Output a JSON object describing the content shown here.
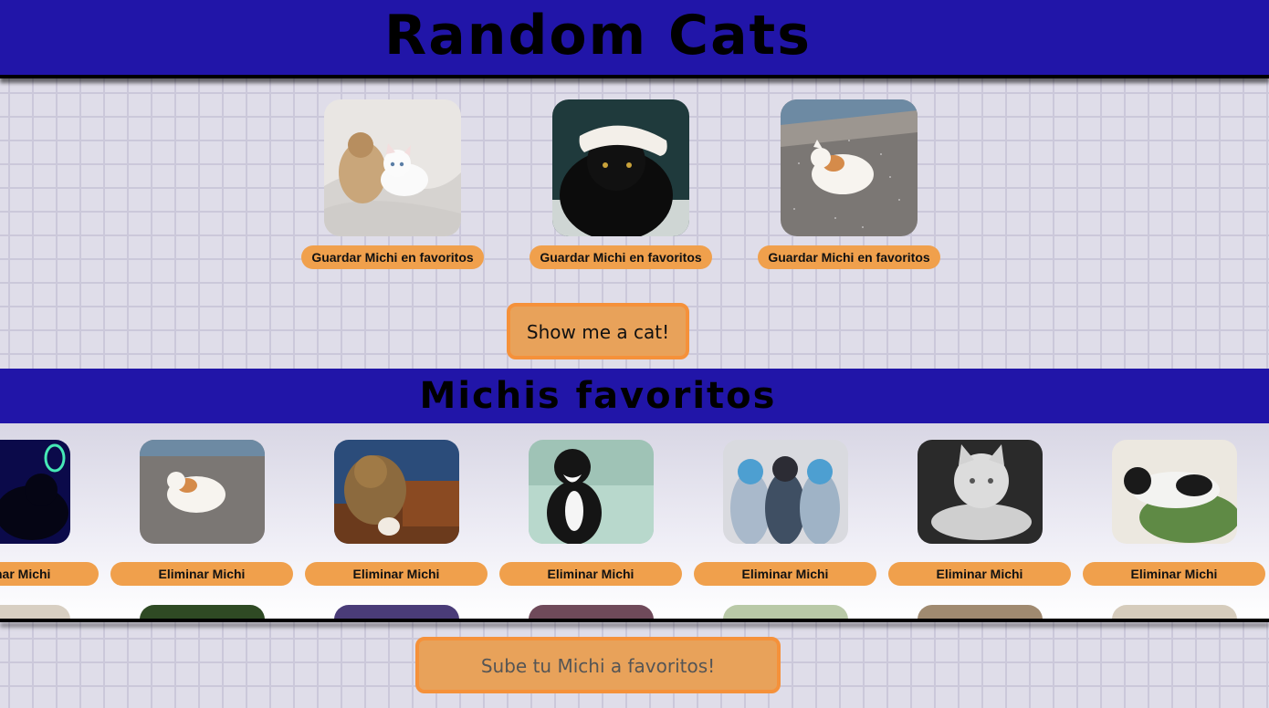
{
  "header": {
    "title": "Random Cats"
  },
  "random_cats": [
    {
      "image": "kitten-with-teddy-bear",
      "save_label": "Guardar Michi en favoritos"
    },
    {
      "image": "black-cat-with-white-hat",
      "save_label": "Guardar Michi en favoritos"
    },
    {
      "image": "cat-lying-on-gravel",
      "save_label": "Guardar Michi en favoritos"
    }
  ],
  "show_button": "Show me a cat!",
  "favorites": {
    "title": "Michis favoritos",
    "items": [
      {
        "image": "black-cat-neon",
        "delete_label": "Eliminar Michi"
      },
      {
        "image": "cat-lying-on-gravel",
        "delete_label": "Eliminar Michi"
      },
      {
        "image": "giant-cat-over-building",
        "delete_label": "Eliminar Michi"
      },
      {
        "image": "tuxedo-cat-in-bath",
        "delete_label": "Eliminar Michi"
      },
      {
        "image": "kittens-in-knit-hats",
        "delete_label": "Eliminar Michi"
      },
      {
        "image": "white-cat-black-and-white-photo",
        "delete_label": "Eliminar Michi"
      },
      {
        "image": "cat-on-green-cushion",
        "delete_label": "Eliminar Michi"
      }
    ]
  },
  "upload_button": "Sube tu Michi a favoritos!",
  "colors": {
    "header": "#2115a8",
    "button": "#f0a04c",
    "background": "#dfdde9"
  }
}
